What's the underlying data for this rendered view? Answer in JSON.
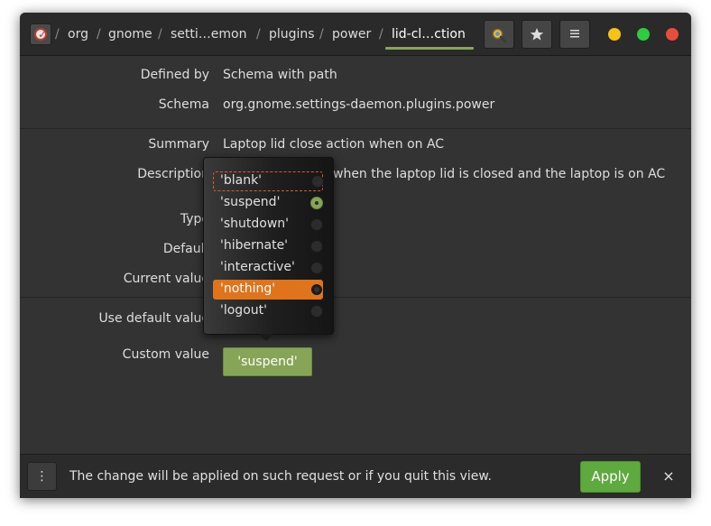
{
  "breadcrumb": {
    "items": [
      "org",
      "gnome",
      "setti…emon",
      "plugins",
      "power",
      "lid-cl…ction"
    ],
    "separator": "/"
  },
  "header": {
    "search_icon": "search-icon",
    "bookmark_icon": "star-icon",
    "menu_icon": "hamburger-icon",
    "window_controls": {
      "minimize": "#f5c316",
      "maximize": "#2ecc40",
      "close": "#e74c3c"
    }
  },
  "fields": {
    "defined_by": {
      "label": "Defined by",
      "value": "Schema with path"
    },
    "schema": {
      "label": "Schema",
      "value": "org.gnome.settings-daemon.plugins.power"
    },
    "summary": {
      "label": "Summary",
      "value": "Laptop lid close action when on AC"
    },
    "description": {
      "label": "Description",
      "value": "when the laptop lid is closed and the laptop is on AC"
    },
    "type": {
      "label": "Type"
    },
    "default": {
      "label": "Default"
    },
    "current_value": {
      "label": "Current value"
    },
    "use_default_value": {
      "label": "Use default value"
    },
    "custom_value": {
      "label": "Custom value",
      "value": "'suspend'"
    }
  },
  "popover": {
    "options": [
      "'blank'",
      "'suspend'",
      "'shutdown'",
      "'hibernate'",
      "'interactive'",
      "'nothing'",
      "'logout'"
    ],
    "checked": "'suspend'",
    "highlighted": "'nothing'",
    "focused": "'blank'"
  },
  "bottombar": {
    "menu_label": "⋮",
    "message": "The change will be applied on such request or if you quit this view.",
    "apply_label": "Apply",
    "close_label": "×"
  },
  "colors": {
    "accent": "#87a556",
    "highlight": "#e0741c",
    "apply": "#5faa3e"
  }
}
